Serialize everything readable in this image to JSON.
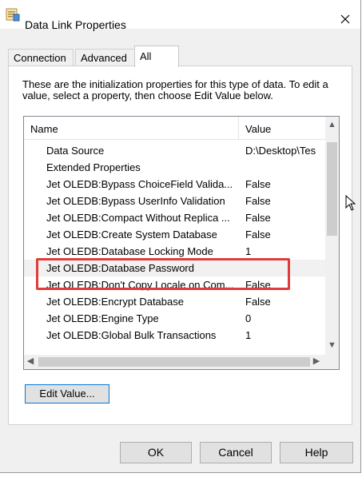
{
  "window": {
    "title": "Data Link Properties",
    "icon": "data-link-icon",
    "close_icon": "close-icon"
  },
  "tabs": [
    {
      "label": "Connection",
      "active": false
    },
    {
      "label": "Advanced",
      "active": false
    },
    {
      "label": "All",
      "active": true
    }
  ],
  "description": "These are the initialization properties for this type of data. To edit a value, select a property, then choose Edit Value below.",
  "grid": {
    "columns": [
      "Name",
      "Value"
    ],
    "rows": [
      {
        "name": "Data Source",
        "value": "D:\\Desktop\\Tes"
      },
      {
        "name": "Extended Properties",
        "value": ""
      },
      {
        "name": "Jet OLEDB:Bypass ChoiceField Valida...",
        "value": "False"
      },
      {
        "name": "Jet OLEDB:Bypass UserInfo Validation",
        "value": "False"
      },
      {
        "name": "Jet OLEDB:Compact Without Replica ...",
        "value": "False"
      },
      {
        "name": "Jet OLEDB:Create System Database",
        "value": "False"
      },
      {
        "name": "Jet OLEDB:Database Locking Mode",
        "value": "1"
      },
      {
        "name": "Jet OLEDB:Database Password",
        "value": "",
        "selected": true
      },
      {
        "name": "Jet OLEDB:Don't Copy Locale on Com...",
        "value": "False"
      },
      {
        "name": "Jet OLEDB:Encrypt Database",
        "value": "False"
      },
      {
        "name": "Jet OLEDB:Engine Type",
        "value": "0"
      },
      {
        "name": "Jet OLEDB:Global Bulk Transactions",
        "value": "1"
      }
    ],
    "highlight_color": "#e03c3c"
  },
  "edit_button": "Edit Value...",
  "buttons": {
    "ok": "OK",
    "cancel": "Cancel",
    "help": "Help"
  }
}
